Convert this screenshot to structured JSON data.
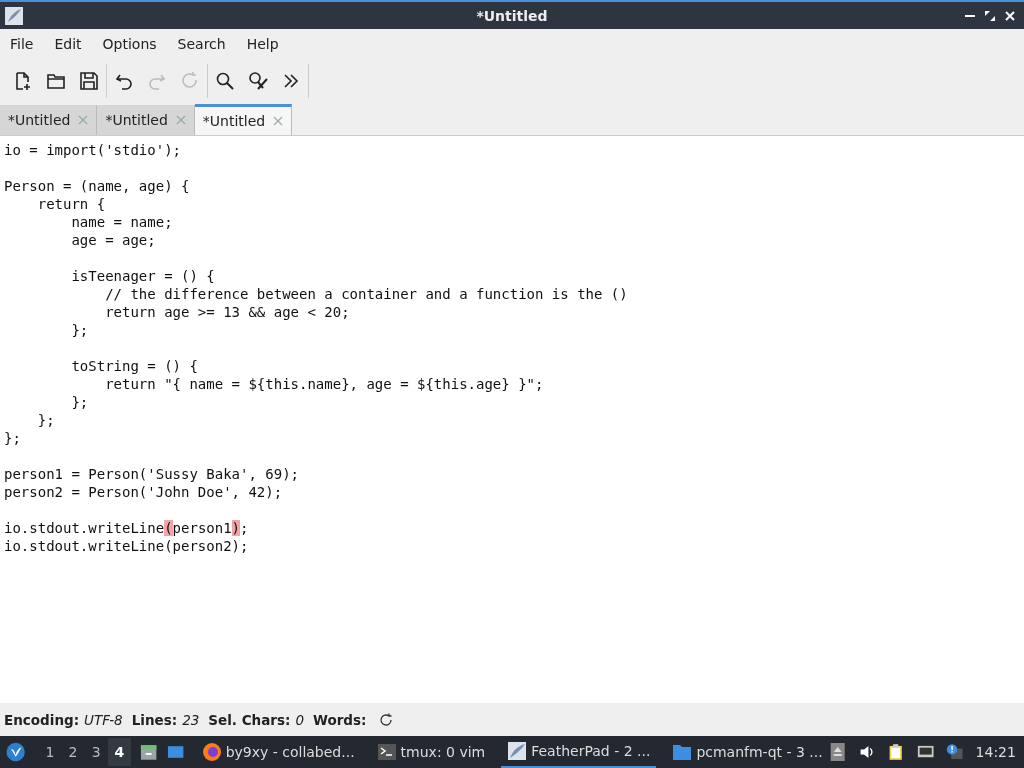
{
  "window": {
    "title": "*Untitled"
  },
  "menu": [
    "File",
    "Edit",
    "Options",
    "Search",
    "Help"
  ],
  "toolbar": [
    [
      {
        "kind": "new",
        "disabled": false
      },
      {
        "kind": "open",
        "disabled": false
      },
      {
        "kind": "save",
        "disabled": false
      }
    ],
    [
      {
        "kind": "undo",
        "disabled": false
      },
      {
        "kind": "redo",
        "disabled": true
      },
      {
        "kind": "reload",
        "disabled": true
      }
    ],
    [
      {
        "kind": "find",
        "disabled": false
      },
      {
        "kind": "replace",
        "disabled": false
      },
      {
        "kind": "more",
        "disabled": false
      }
    ]
  ],
  "tabs": [
    {
      "label": "*Untitled",
      "selected": false
    },
    {
      "label": "*Untitled",
      "selected": false
    },
    {
      "label": "*Untitled",
      "selected": true
    }
  ],
  "editor": {
    "lines": [
      {
        "kind": "code",
        "text": "io = import('stdio');"
      },
      {
        "kind": "blank"
      },
      {
        "kind": "code",
        "text": "Person = (name, age) {"
      },
      {
        "kind": "code",
        "text": "    return {"
      },
      {
        "kind": "code",
        "text": "        name = name;"
      },
      {
        "kind": "code",
        "text": "        age = age;"
      },
      {
        "kind": "blank"
      },
      {
        "kind": "code",
        "text": "        isTeenager = () {"
      },
      {
        "kind": "code",
        "text": "            // the difference between a container and a function is the ()"
      },
      {
        "kind": "code",
        "text": "            return age >= 13 && age < 20;"
      },
      {
        "kind": "code",
        "text": "        };"
      },
      {
        "kind": "blank"
      },
      {
        "kind": "code",
        "text": "        toString = () {"
      },
      {
        "kind": "code",
        "text": "            return \"{ name = ${this.name}, age = ${this.age} }\";"
      },
      {
        "kind": "code",
        "text": "        };"
      },
      {
        "kind": "code",
        "text": "    };"
      },
      {
        "kind": "code",
        "text": "};"
      },
      {
        "kind": "blank"
      },
      {
        "kind": "code",
        "text": "person1 = Person('Sussy Baka', 69);"
      },
      {
        "kind": "code",
        "text": "person2 = Person('John Doe', 42);"
      },
      {
        "kind": "blank"
      },
      {
        "kind": "parts",
        "parts": [
          {
            "text": "io.stdout.writeLine",
            "match": false
          },
          {
            "text": "(",
            "match": true
          },
          {
            "text": "person1",
            "match": false
          },
          {
            "text": ")",
            "match": true
          },
          {
            "text": ";",
            "match": false
          }
        ]
      },
      {
        "kind": "code",
        "text": "io.stdout.writeLine(person2);"
      }
    ]
  },
  "status_bar": [
    {
      "label": "Encoding:",
      "value": "UTF-8"
    },
    {
      "label": "Lines:",
      "value": "23"
    },
    {
      "label": "Sel. Chars:",
      "value": "0"
    },
    {
      "label": "Words:"
    }
  ],
  "taskbar": {
    "desktops": [
      {
        "label": "1",
        "selected": false
      },
      {
        "label": "2",
        "selected": false
      },
      {
        "label": "3",
        "selected": false
      },
      {
        "label": "4",
        "selected": true
      }
    ],
    "tasks": [
      {
        "kind": "browser",
        "label": "by9xy - collabed...",
        "selected": false
      },
      {
        "kind": "terminal",
        "label": "tmux: 0 vim",
        "selected": false
      },
      {
        "kind": "editor",
        "label": "FeatherPad - 2 ...",
        "selected": true
      },
      {
        "kind": "folder",
        "label": "pcmanfm-qt - 3 ...",
        "selected": false
      }
    ],
    "clock": "14:21"
  }
}
